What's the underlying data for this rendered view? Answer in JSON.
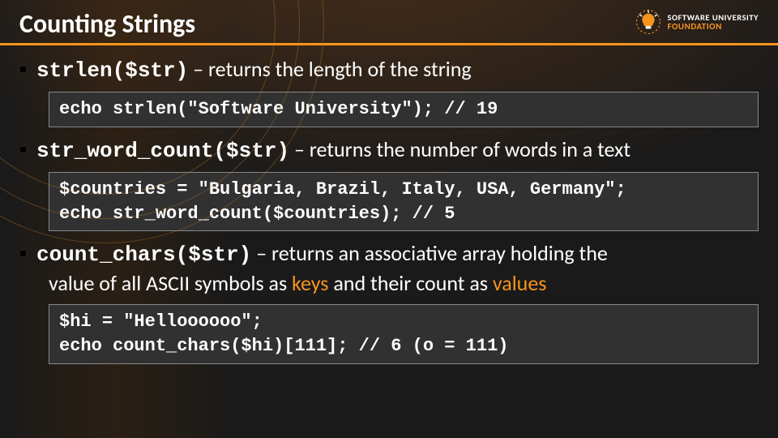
{
  "title": "Counting Strings",
  "logo": {
    "line1": "SOFTWARE UNIVERSITY",
    "line2": "FOUNDATION"
  },
  "items": [
    {
      "fn": "strlen($str)",
      "sep": " – ",
      "desc": "returns the length of the string",
      "code": "echo strlen(\"Software University\"); // 19"
    },
    {
      "fn": "str_word_count($str)",
      "sep": " – ",
      "desc": "returns the number of words in a text",
      "code": "$countries = \"Bulgaria, Brazil, Italy, USA, Germany\";\necho str_word_count($countries); // 5"
    },
    {
      "fn": "count_chars($str)",
      "sep": " – ",
      "desc_pre": "returns an associative array holding the",
      "desc_line2a": "value of all ASCII symbols as ",
      "keys": "keys",
      "desc_line2b": " and their count as ",
      "values": "values",
      "code": "$hi = \"Helloooooo\";\necho count_chars($hi)[111]; // 6 (o = 111)"
    }
  ]
}
